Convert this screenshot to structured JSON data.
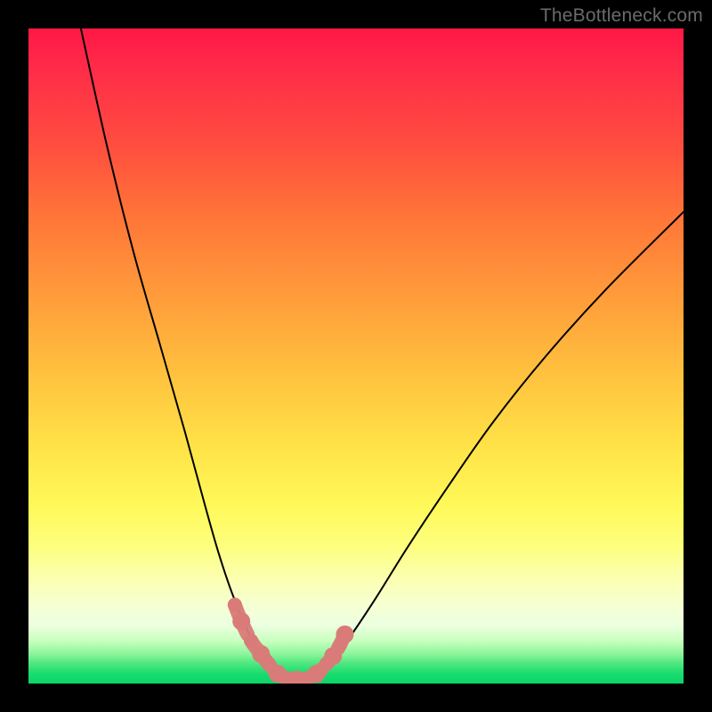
{
  "watermark": {
    "text": "TheBottleneck.com"
  },
  "colors": {
    "curve_stroke": "#000000",
    "marker_fill": "#d97b78",
    "marker_stroke": "#c76763",
    "background_black": "#000000"
  },
  "chart_data": {
    "type": "line",
    "title": "",
    "xlabel": "",
    "ylabel": "",
    "xlim": [
      0,
      100
    ],
    "ylim": [
      0,
      100
    ],
    "note": "Values are approximate, read from shape of the rendered curve on a 0–100 axis (x left→right, y bottom→top).",
    "series": [
      {
        "name": "left-arm",
        "x": [
          8,
          12,
          16,
          20,
          24,
          27,
          29,
          31,
          33,
          34.5,
          36,
          37,
          38
        ],
        "y": [
          100,
          82,
          66,
          52,
          38,
          27,
          20,
          14,
          9,
          6,
          3.5,
          2,
          1
        ]
      },
      {
        "name": "valley",
        "x": [
          38,
          39,
          40,
          41,
          42,
          43,
          44
        ],
        "y": [
          1,
          0.6,
          0.4,
          0.35,
          0.4,
          0.6,
          1
        ]
      },
      {
        "name": "right-arm",
        "x": [
          44,
          46,
          49,
          53,
          58,
          64,
          71,
          79,
          88,
          100
        ],
        "y": [
          1,
          3,
          7,
          13,
          21,
          30,
          40,
          50,
          60,
          72
        ]
      }
    ],
    "markers": {
      "name": "highlighted-points",
      "x": [
        31.5,
        32.5,
        34,
        35.5,
        36.5,
        38,
        39.5,
        41,
        42.5,
        44,
        45.5,
        46.5,
        47.5,
        48.3
      ],
      "y": [
        12,
        9.5,
        6.5,
        4.5,
        3.2,
        1.5,
        0.8,
        0.6,
        0.8,
        1.5,
        3,
        4.2,
        5.8,
        7.5
      ]
    }
  }
}
